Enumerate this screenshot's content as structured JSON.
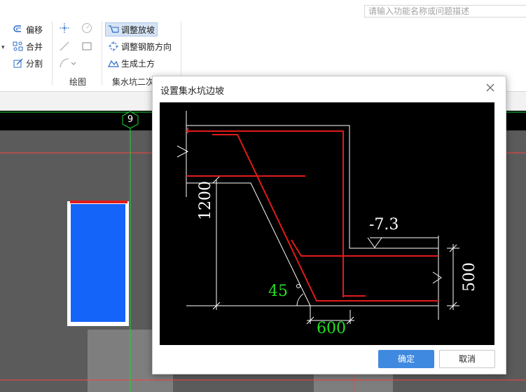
{
  "search": {
    "placeholder": "请输入功能名称或问题描述"
  },
  "ribbon": {
    "group1": {
      "offset": "偏移",
      "merge": "合并",
      "split": "分割"
    },
    "draw_group_label": "绘图",
    "group3": {
      "adjust_slope": "调整放坡",
      "adjust_rebar_dir": "调整钢筋方向",
      "gen_earthwork": "生成土方",
      "label": "集水坑二次"
    }
  },
  "canvas": {
    "axis_label": "9"
  },
  "dialog": {
    "title": "设置集水坑边坡",
    "figure": {
      "dim_height": "1200",
      "dim_angle": "45",
      "dim_width": "600",
      "elevation": "-7.3",
      "dim_depth": "500"
    },
    "ok_label": "确定",
    "cancel_label": "取消"
  },
  "colors": {
    "accent": "#3f8ae0",
    "rebar": "#e01b1b",
    "dim_green": "#22e022",
    "pit_blue": "#1464fa"
  }
}
